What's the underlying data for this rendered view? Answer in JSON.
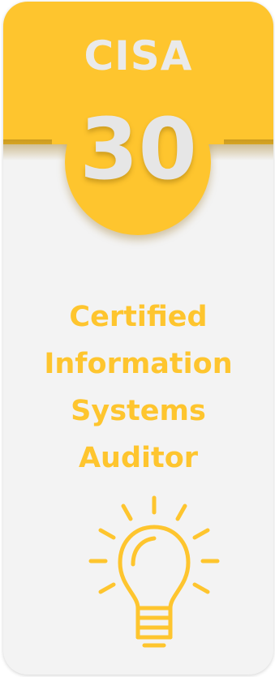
{
  "card": {
    "acronym": "CISA",
    "number": "30",
    "title_lines": [
      "Certified",
      "Information",
      "Systems",
      "Auditor"
    ]
  },
  "icon": "lightbulb-icon",
  "colors": {
    "accent": "#fec52e",
    "card_background": "#f3f3f3",
    "banner_text": "#eaeaea"
  }
}
